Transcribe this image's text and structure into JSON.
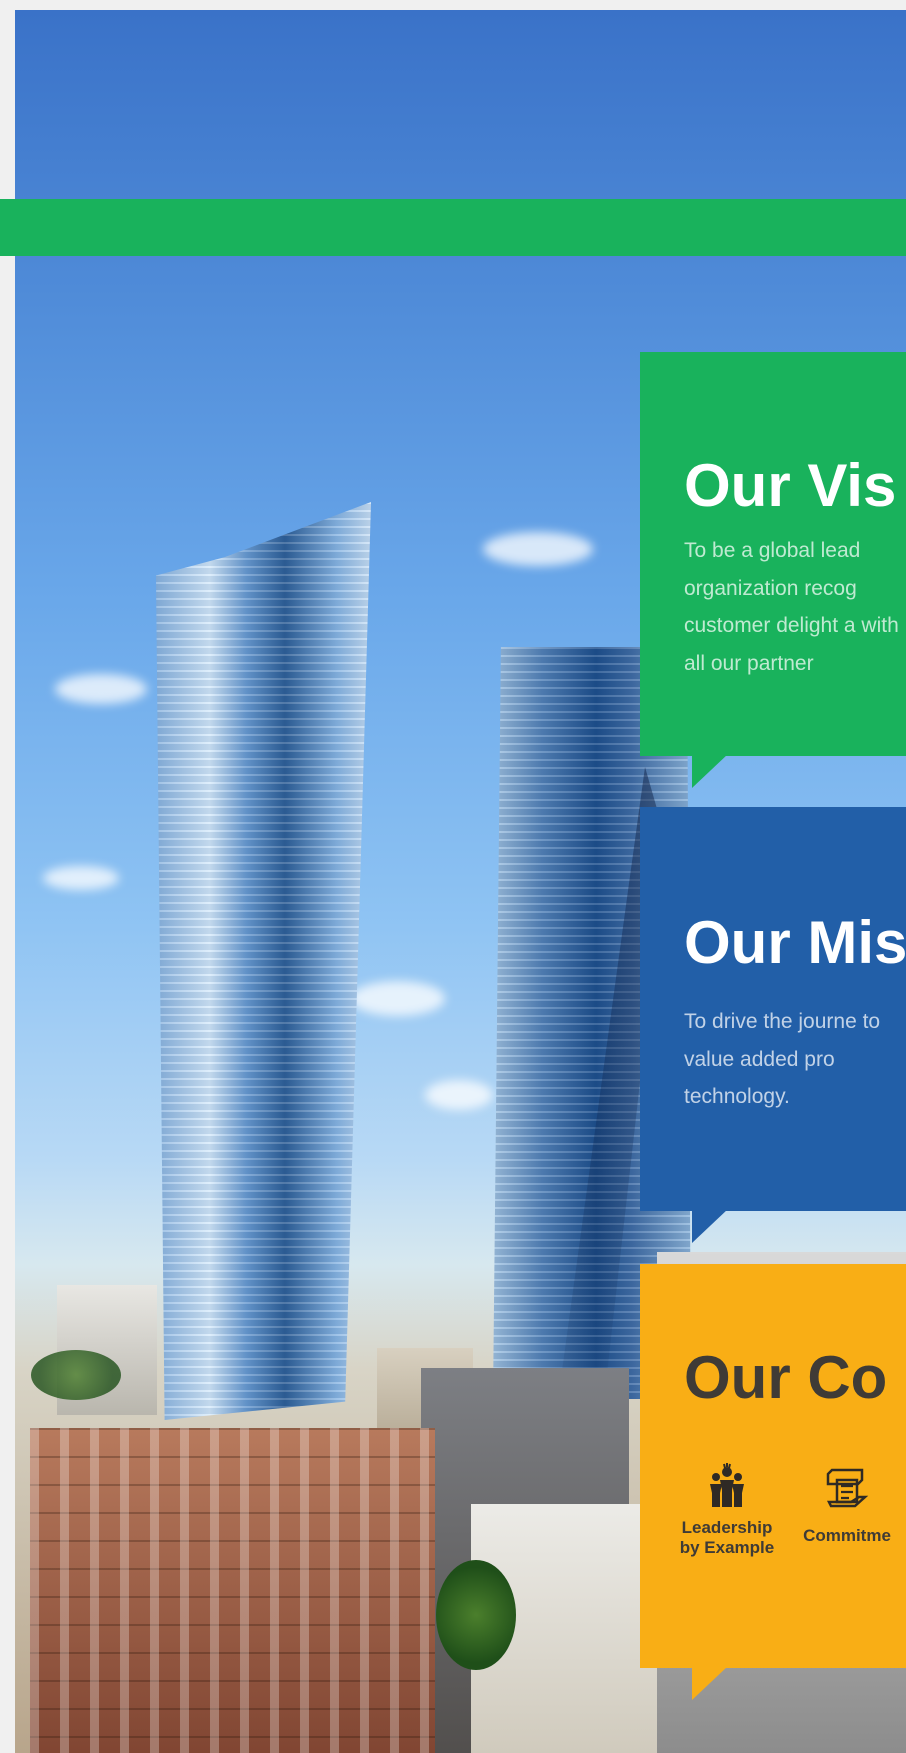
{
  "background": {
    "sky_color": "#4f8bd8",
    "accent_strip_color": "#19b25c"
  },
  "vision": {
    "title": "Our Vis",
    "text": "To be a global lead organization recog customer delight a with all our partner",
    "color": "#19b25c"
  },
  "mission": {
    "title": "Our Mis",
    "text": "To drive the journe to value added pro technology.",
    "color": "#225fa8"
  },
  "core": {
    "title": "Our Co",
    "color": "#f9ae15",
    "values": [
      {
        "icon": "people-icon",
        "label": "Leadership by Example"
      },
      {
        "icon": "commitment-icon",
        "label": "Commitme"
      }
    ]
  }
}
